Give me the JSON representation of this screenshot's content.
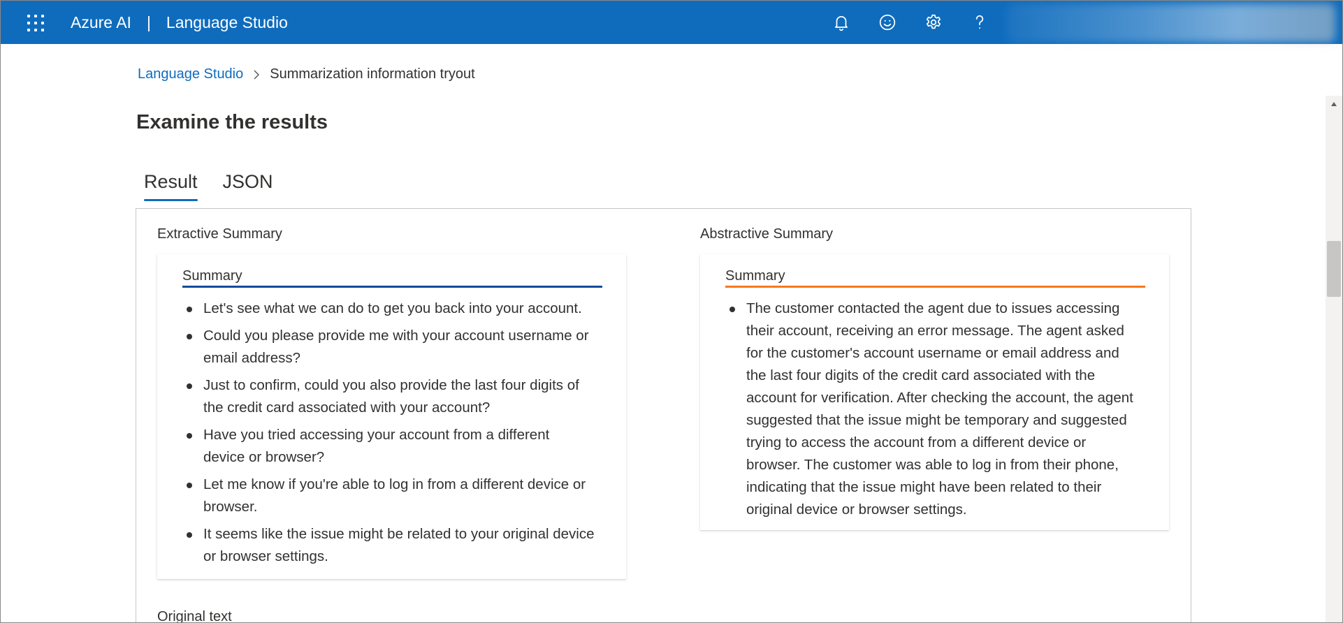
{
  "header": {
    "product": "Azure AI",
    "separator": "|",
    "app": "Language Studio",
    "icons": [
      "bell-icon",
      "smiley-feedback-icon",
      "gear-icon",
      "help-icon"
    ]
  },
  "breadcrumb": {
    "root": "Language Studio",
    "current": "Summarization information tryout"
  },
  "page": {
    "title": "Examine the results"
  },
  "tabs": [
    {
      "label": "Result",
      "active": true
    },
    {
      "label": "JSON",
      "active": false
    }
  ],
  "extractive": {
    "section_label": "Extractive Summary",
    "card_title": "Summary",
    "accent": "#0f4c9e",
    "items": [
      "Let's see what we can do to get you back into your account.",
      "Could you please provide me with your account username or email address?",
      "Just to confirm, could you also provide the last four digits of the credit card associated with your account?",
      "Have you tried accessing your account from a different device or browser?",
      "Let me know if you're able to log in from a different device or browser.",
      "It seems like the issue might be related to your original device or browser settings."
    ]
  },
  "abstractive": {
    "section_label": "Abstractive Summary",
    "card_title": "Summary",
    "accent": "#f7781e",
    "items": [
      "The customer contacted the agent due to issues accessing their account, receiving an error message. The agent asked for the customer's account username or email address and the last four digits of the credit card associated with the account for verification. After checking the account, the agent suggested that the issue might be temporary and suggested trying to access the account from a different device or browser. The customer was able to log in from their phone, indicating that the issue might have been related to their original device or browser settings."
    ]
  },
  "original_text": {
    "label": "Original text"
  },
  "colors": {
    "topbar": "#0f6cbd",
    "link": "#0f6cbd"
  }
}
